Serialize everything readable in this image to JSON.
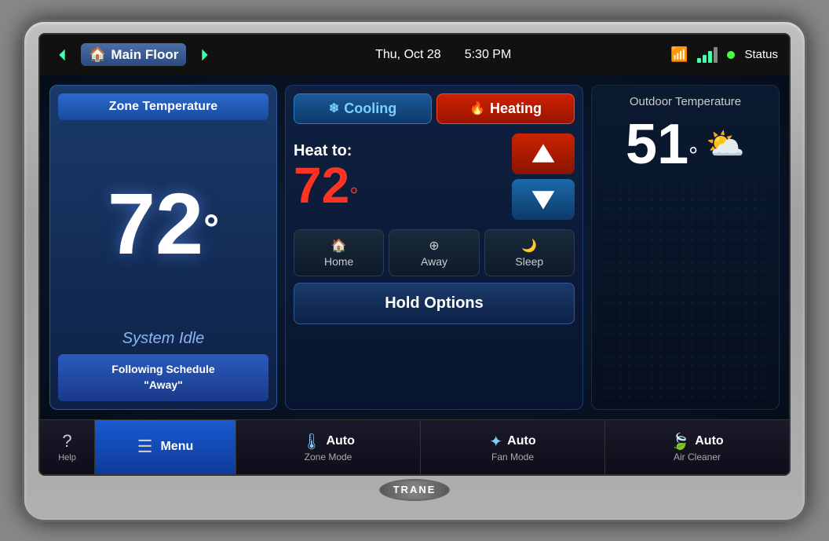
{
  "device": {
    "brand": "TRANE"
  },
  "header": {
    "back_arrow": "◀",
    "forward_arrow": "▶",
    "location": "Main Floor",
    "date": "Thu, Oct 28",
    "time": "5:30 PM",
    "status_label": "Status"
  },
  "zone": {
    "title": "Zone Temperature",
    "current_temp": "72",
    "temp_unit": "°",
    "status": "System Idle",
    "schedule": "Following Schedule",
    "schedule_mode": "\"Away\""
  },
  "controls": {
    "cooling_label": "Cooling",
    "heating_label": "Heating",
    "heat_to_label": "Heat to:",
    "setpoint": "72",
    "setpoint_unit": "°",
    "home_label": "Home",
    "away_label": "Away",
    "sleep_label": "Sleep",
    "hold_options_label": "Hold Options"
  },
  "outdoor": {
    "title": "Outdoor Temperature",
    "temp": "51",
    "temp_unit": "°"
  },
  "bottom_bar": {
    "help_label": "Help",
    "menu_label": "Menu",
    "zone_mode_top": "Auto",
    "zone_mode_label": "Zone Mode",
    "fan_mode_top": "Auto",
    "fan_mode_label": "Fan Mode",
    "air_cleaner_top": "Auto",
    "air_cleaner_label": "Air Cleaner"
  }
}
